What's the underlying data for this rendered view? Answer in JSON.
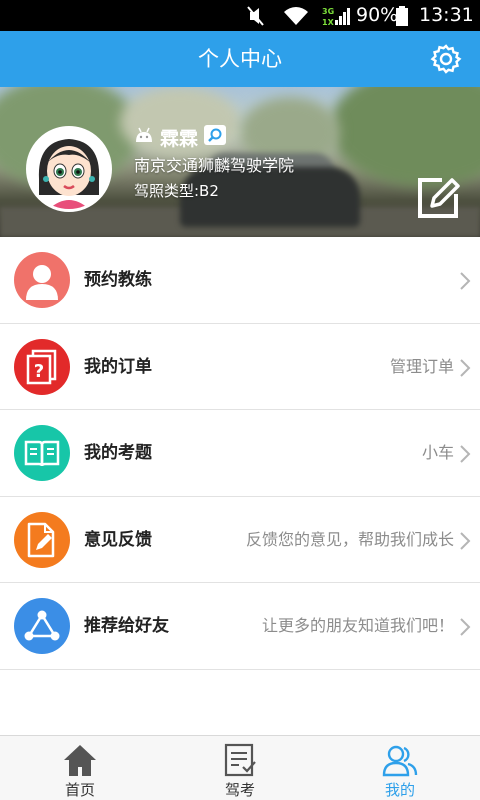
{
  "status_bar": {
    "battery": "90%",
    "time": "13:31",
    "network": "3G"
  },
  "header": {
    "title": "个人中心",
    "settings_icon": "gear-icon"
  },
  "profile": {
    "username": "霖霖",
    "school": "南京交通狮麟驾驶学院",
    "license": "驾照类型:B2"
  },
  "menu": [
    {
      "label": "预约教练",
      "hint": "",
      "icon": "person-icon",
      "color": "#f0726a"
    },
    {
      "label": "我的订单",
      "hint": "管理订单",
      "icon": "order-icon",
      "color": "#e22a2a"
    },
    {
      "label": "我的考题",
      "hint": "小车",
      "icon": "book-icon",
      "color": "#17c6a8"
    },
    {
      "label": "意见反馈",
      "hint": "反馈您的意见，帮助我们成长",
      "icon": "feedback-icon",
      "color": "#f47b1e"
    },
    {
      "label": "推荐给好友",
      "hint": "让更多的朋友知道我们吧！",
      "icon": "share-icon",
      "color": "#3b8ee6"
    }
  ],
  "tabs": [
    {
      "label": "首页",
      "icon": "home-icon"
    },
    {
      "label": "驾考",
      "icon": "exam-icon"
    },
    {
      "label": "我的",
      "icon": "profile-icon",
      "active": true
    }
  ],
  "colors": {
    "accent": "#2ea0ea"
  }
}
